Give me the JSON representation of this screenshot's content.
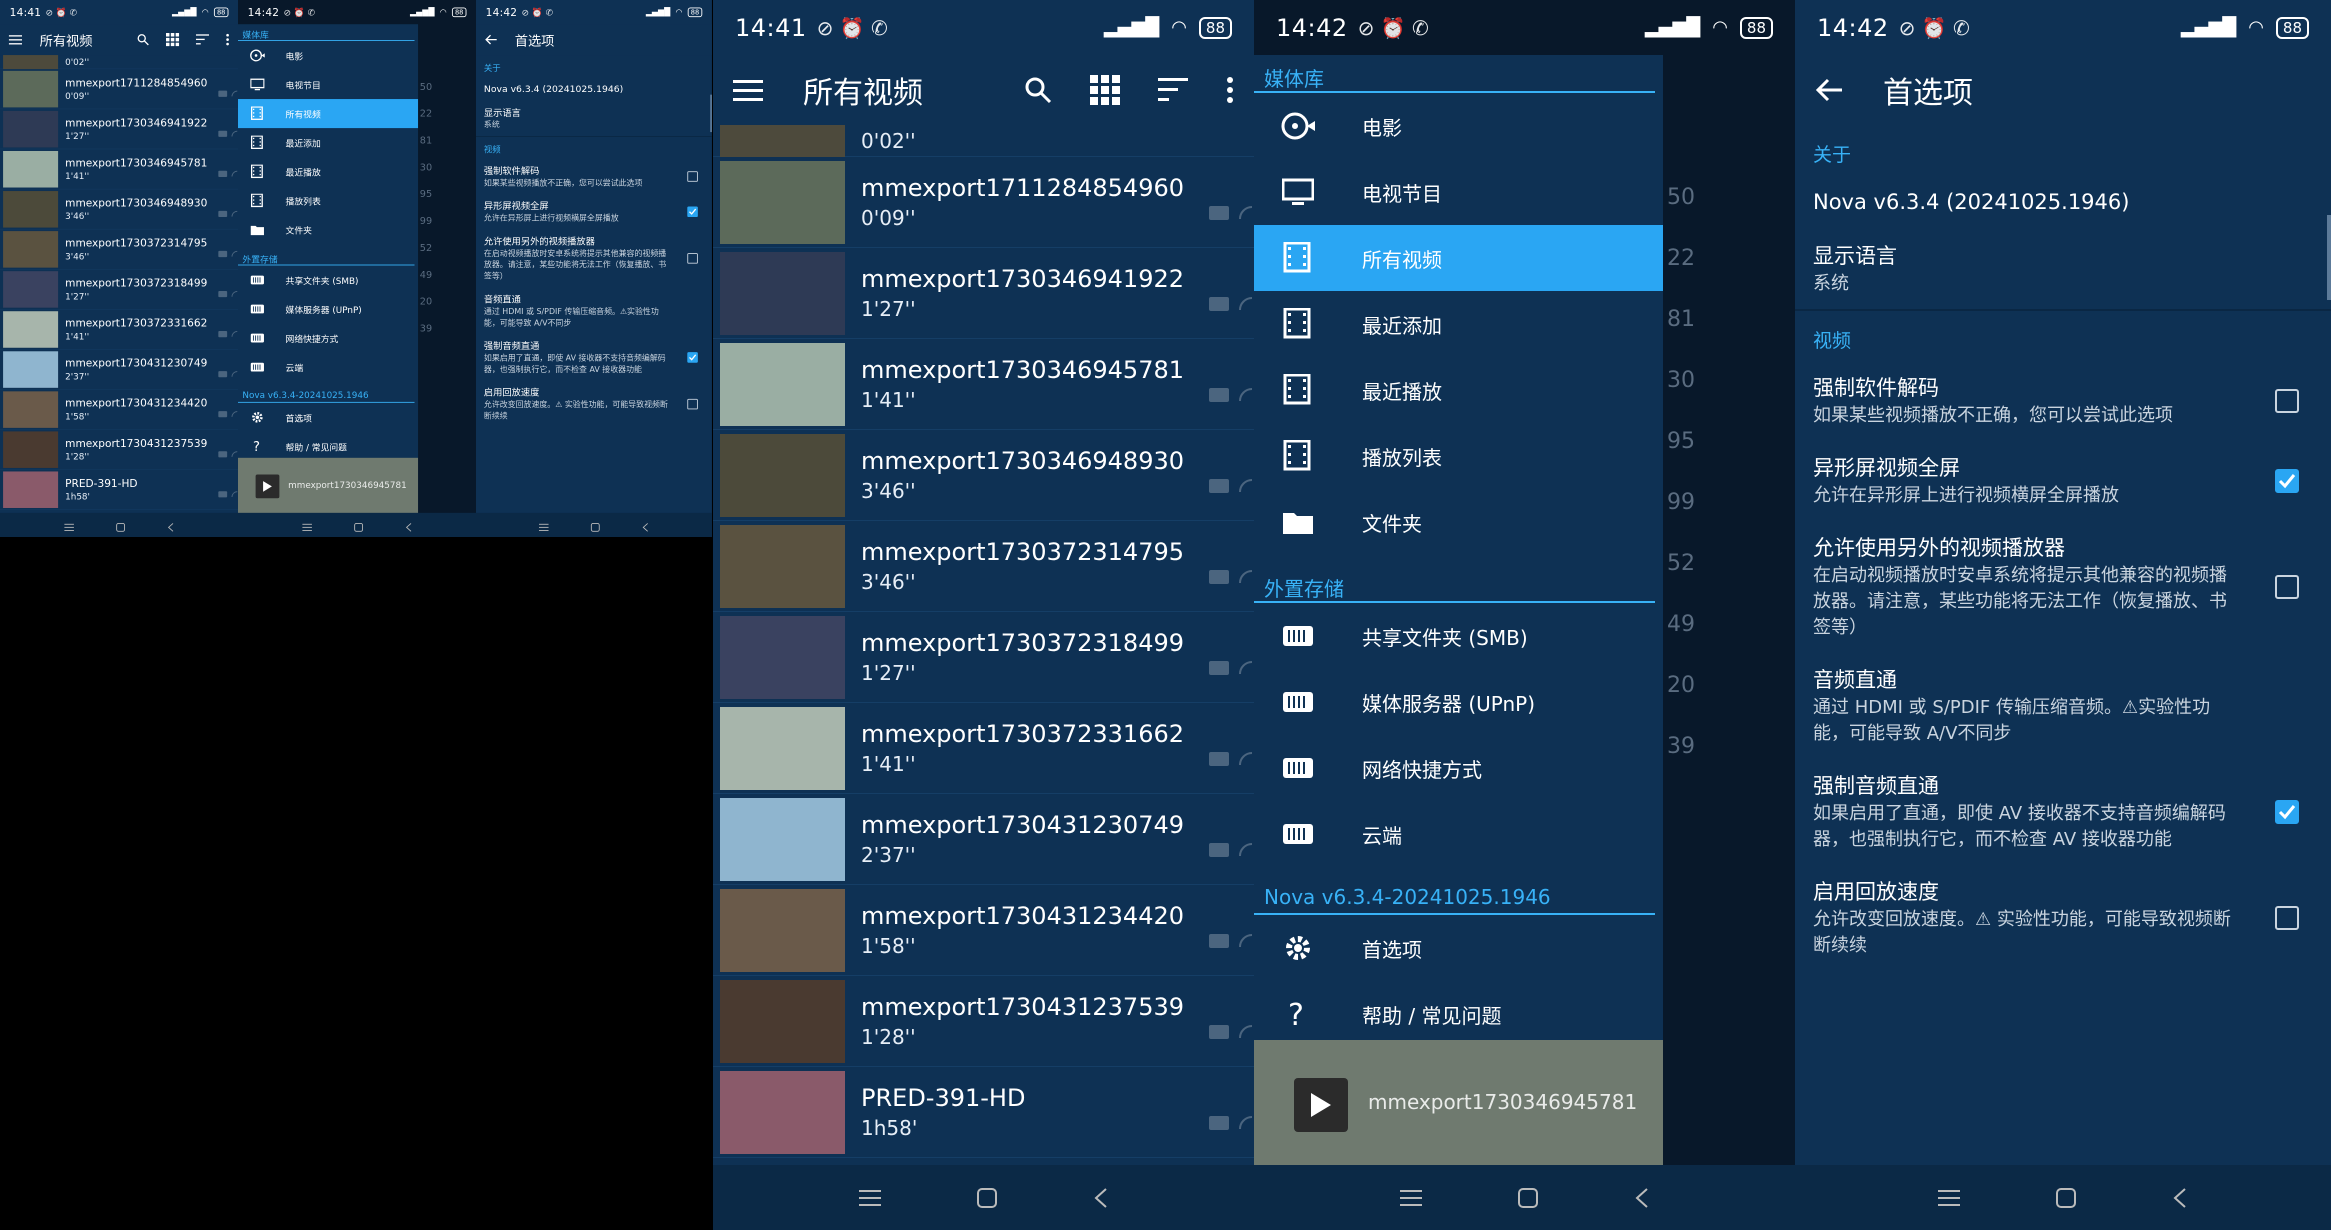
{
  "status": {
    "time1": "14:41",
    "time2": "14:42",
    "time3": "14:42",
    "battery": "88",
    "net": "HD",
    "small_time1": "14:41",
    "small_time2": "14:42",
    "small_time3": "14:42"
  },
  "videos": {
    "title": "所有视频",
    "first_duration": "0'02''",
    "items": [
      {
        "name": "mmexport1711284854960",
        "duration": "0'09''"
      },
      {
        "name": "mmexport1730346941922",
        "duration": "1'27''"
      },
      {
        "name": "mmexport1730346945781",
        "duration": "1'41''"
      },
      {
        "name": "mmexport1730346948930",
        "duration": "3'46''"
      },
      {
        "name": "mmexport1730372314795",
        "duration": "3'46''"
      },
      {
        "name": "mmexport1730372318499",
        "duration": "1'27''"
      },
      {
        "name": "mmexport1730372331662",
        "duration": "1'41''"
      },
      {
        "name": "mmexport1730431230749",
        "duration": "2'37''"
      },
      {
        "name": "mmexport1730431234420",
        "duration": "1'58''"
      },
      {
        "name": "mmexport1730431237539",
        "duration": "1'28''"
      },
      {
        "name": "PRED-391-HD",
        "duration": "1h58'"
      }
    ]
  },
  "drawer": {
    "section_library": "媒体库",
    "library_items": [
      "电影",
      "电视节目",
      "所有视频",
      "最近添加",
      "最近播放",
      "播放列表",
      "文件夹"
    ],
    "section_external": "外置存储",
    "external_items": [
      "共享文件夹 (SMB)",
      "媒体服务器 (UPnP)",
      "网络快捷方式",
      "云端"
    ],
    "version": "Nova v6.3.4-20241025.1946",
    "bottom_items": [
      "首选项",
      "帮助 / 常见问题"
    ],
    "player_title": "mmexport1730346945781",
    "ghost_numbers": [
      "50",
      "22",
      "81",
      "30",
      "95",
      "99",
      "52",
      "49",
      "20",
      "39"
    ]
  },
  "settings": {
    "title": "首选项",
    "cat_about": "关于",
    "version": "Nova v6.3.4 (20241025.1946)",
    "lang_title": "显示语言",
    "lang_value": "系统",
    "cat_video": "视频",
    "items": [
      {
        "title": "强制软件解码",
        "sub": "如果某些视频播放不正确，您可以尝试此选项",
        "checked": false
      },
      {
        "title": "异形屏视频全屏",
        "sub": "允许在异形屏上进行视频横屏全屏播放",
        "checked": true
      },
      {
        "title": "允许使用另外的视频播放器",
        "sub": "在启动视频播放时安卓系统将提示其他兼容的视频播放器。请注意，某些功能将无法工作（恢复播放、书签等）",
        "checked": false
      },
      {
        "title": "音频直通",
        "sub": "通过 HDMI 或 S/PDIF 传输压缩音频。⚠实验性功能，可能导致 A/V不同步",
        "checked": null
      },
      {
        "title": "强制音频直通",
        "sub": "如果启用了直通，即使 AV 接收器不支持音频编解码器，也强制执行它，而不检查 AV 接收器功能",
        "checked": true
      },
      {
        "title": "启用回放速度",
        "sub": "允许改变回放速度。⚠ 实验性功能，可能导致视频断断续续",
        "checked": false
      }
    ]
  },
  "colors": {
    "bg": "#0e3154",
    "accent": "#2aa6f3",
    "section": "#38b2f7"
  }
}
